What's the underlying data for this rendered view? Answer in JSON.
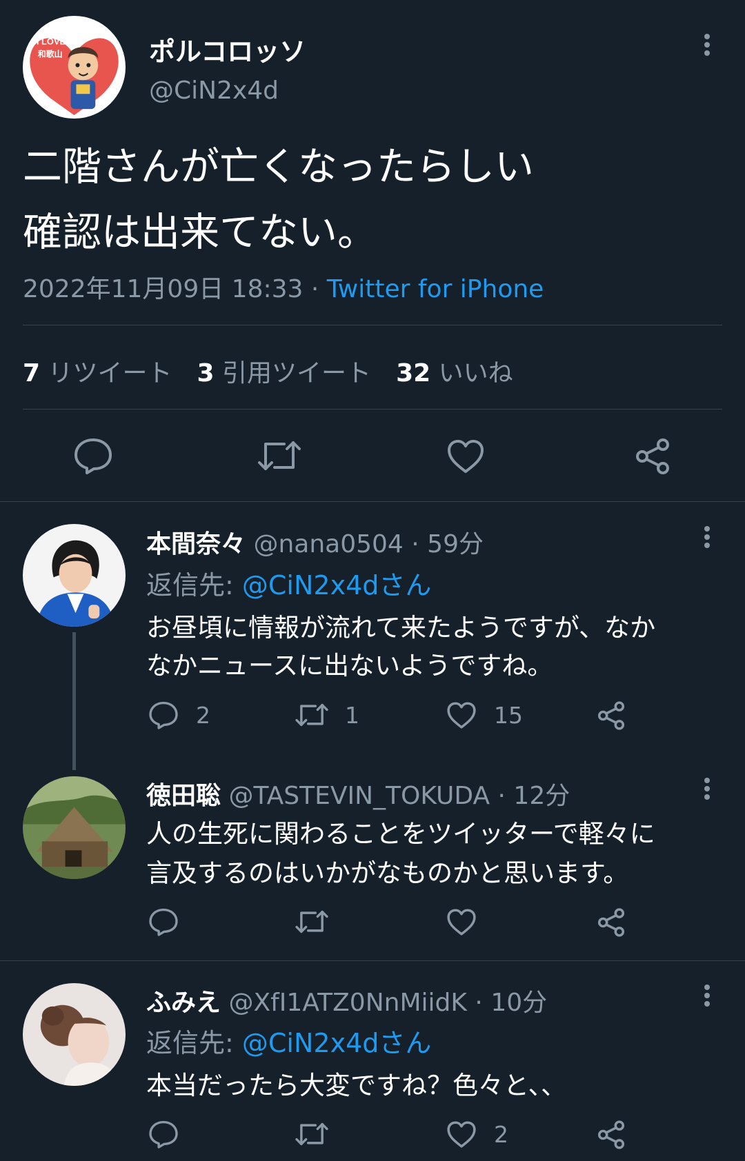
{
  "main_tweet": {
    "display_name": "ポルコロッソ",
    "handle": "@CiN2x4d",
    "avatar_text_1": "I LOVE",
    "avatar_text_2": "和歌山",
    "text_line1": "二階さんが亡くなったらしい",
    "text_line2": "確認は出来てない。",
    "timestamp": "2022年11月09日 18:33 · ",
    "source": "Twitter for iPhone",
    "stats": {
      "retweets_count": "7",
      "retweets_label": "リツイート",
      "quotes_count": "3",
      "quotes_label": "引用ツイート",
      "likes_count": "32",
      "likes_label": "いいね"
    }
  },
  "replies": [
    {
      "display_name": "本間奈々",
      "handle_time": "@nana0504 · 59分",
      "reply_to_prefix": "返信先: ",
      "reply_to_handle": "@CiN2x4dさん",
      "text_line1": "お昼頃に情報が流れて来たようですが、なか",
      "text_line2": "なかニュースに出ないようですね。",
      "reply_count": "2",
      "retweet_count": "1",
      "like_count": "15"
    },
    {
      "display_name": "徳田聡",
      "handle_time": "@TASTEVIN_TOKUDA · 12分",
      "text_line1": "人の生死に関わることをツイッターで軽々に",
      "text_line2": "言及するのはいかがなものかと思います。"
    },
    {
      "display_name": "ふみえ",
      "handle_time": "@XfI1ATZ0NnMiidK · 10分",
      "reply_to_prefix": "返信先: ",
      "reply_to_handle": "@CiN2x4dさん",
      "text_line1": "本当だったら大変ですね？色々と、、",
      "like_count": "2"
    }
  ],
  "colors": {
    "background": "#15202b",
    "text": "#ffffff",
    "muted": "#8b98a5",
    "link": "#1d9bf0",
    "divider": "#38444d"
  }
}
